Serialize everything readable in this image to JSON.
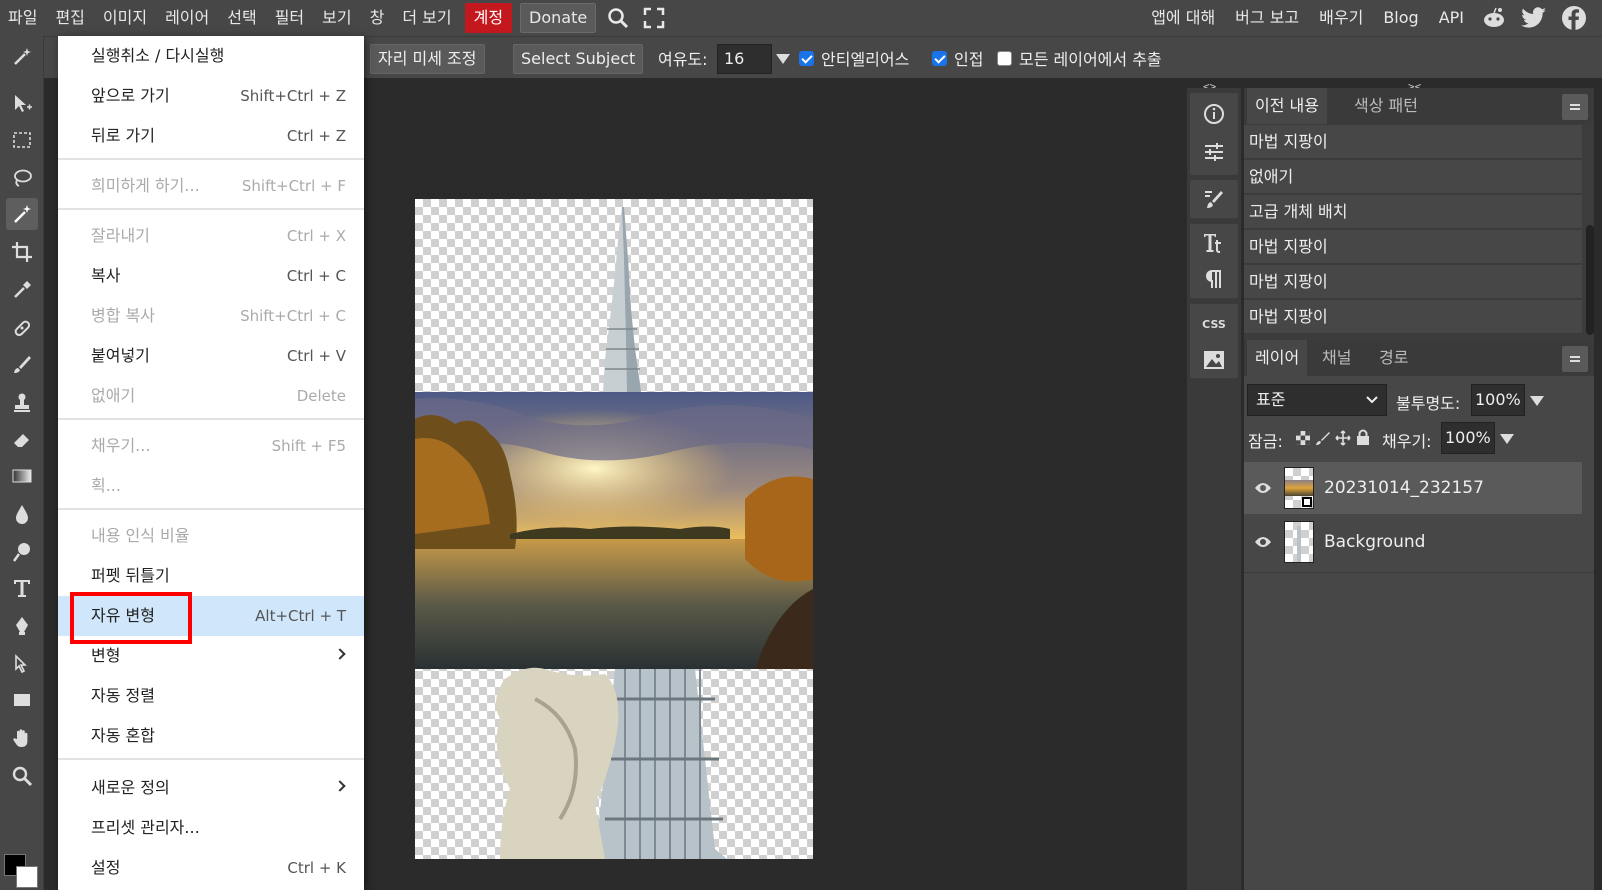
{
  "menubar": {
    "items": [
      "파일",
      "편집",
      "이미지",
      "레이어",
      "선택",
      "필터",
      "보기",
      "창",
      "더 보기"
    ],
    "account": "계정",
    "donate": "Donate",
    "right": [
      "앱에 대해",
      "버그 보고",
      "배우기",
      "Blog",
      "API"
    ],
    "colors": {
      "account_bg": "#c3191e"
    }
  },
  "optbar": {
    "refine_edge": "자리 미세 조정",
    "select_subject": "Select Subject",
    "tolerance_label": "여유도:",
    "tolerance_value": "16",
    "antialias": "안티엘리어스",
    "contiguous": "인접",
    "sample_all": "모든 레이어에서 추출"
  },
  "edit_menu": {
    "items": [
      {
        "label": "실행취소 / 다시실행",
        "shortcut": ""
      },
      {
        "label": "앞으로 가기",
        "shortcut": "Shift+Ctrl + Z"
      },
      {
        "label": "뒤로 가기",
        "shortcut": "Ctrl + Z"
      },
      {
        "label": "희미하게 하기...",
        "shortcut": "Shift+Ctrl + F"
      },
      {
        "label": "잘라내기",
        "shortcut": "Ctrl + X"
      },
      {
        "label": "복사",
        "shortcut": "Ctrl + C"
      },
      {
        "label": "병합 복사",
        "shortcut": "Shift+Ctrl + C"
      },
      {
        "label": "붙여넣기",
        "shortcut": "Ctrl + V"
      },
      {
        "label": "없애기",
        "shortcut": "Delete"
      },
      {
        "label": "채우기...",
        "shortcut": "Shift + F5"
      },
      {
        "label": "획...",
        "shortcut": ""
      },
      {
        "label": "내용 인식 비율",
        "shortcut": ""
      },
      {
        "label": "퍼펫 뒤틀기",
        "shortcut": ""
      },
      {
        "label": "자유 변형",
        "shortcut": "Alt+Ctrl + T"
      },
      {
        "label": "변형",
        "shortcut": ""
      },
      {
        "label": "자동 정렬",
        "shortcut": ""
      },
      {
        "label": "자동 혼합",
        "shortcut": ""
      },
      {
        "label": "새로운 정의",
        "shortcut": ""
      },
      {
        "label": "프리셋 관리자...",
        "shortcut": ""
      },
      {
        "label": "설정",
        "shortcut": "Ctrl + K"
      }
    ]
  },
  "history_panel": {
    "tabs": [
      "이전 내용",
      "색상 패턴"
    ],
    "entries": [
      "마법 지팡이",
      "없애기",
      "고급 개체 배치",
      "마법 지팡이",
      "마법 지팡이",
      "마법 지팡이"
    ]
  },
  "layers_panel": {
    "tabs": [
      "레이어",
      "채널",
      "경로"
    ],
    "blend_mode": "표준",
    "opacity_label": "불투명도:",
    "opacity_value": "100%",
    "lock_label": "잠금:",
    "fill_label": "채우기:",
    "fill_value": "100%",
    "layers": [
      {
        "name": "20231014_232157"
      },
      {
        "name": "Background"
      }
    ]
  },
  "panel_strip": {
    "css_label": "CSS"
  }
}
